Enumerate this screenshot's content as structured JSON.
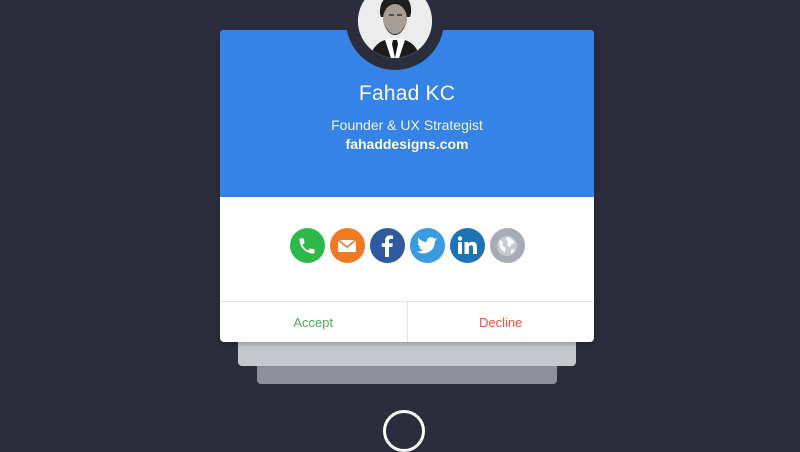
{
  "profile": {
    "name": "Fahad KC",
    "role": "Founder & UX Strategist",
    "website": "fahaddesigns.com"
  },
  "social_icons": [
    {
      "icon": "phone-icon",
      "color": "#2fb84a"
    },
    {
      "icon": "email-icon",
      "color": "#f07a24"
    },
    {
      "icon": "facebook-icon",
      "color": "#2f5aa0"
    },
    {
      "icon": "twitter-icon",
      "color": "#3b9ae0"
    },
    {
      "icon": "linkedin-icon",
      "color": "#1e73b5"
    },
    {
      "icon": "globe-icon",
      "color": "#a6abb6"
    }
  ],
  "actions": {
    "accept_label": "Accept",
    "decline_label": "Decline"
  },
  "colors": {
    "background": "#2b2d3c",
    "header": "#3583e6",
    "accept": "#4caf50",
    "decline": "#f2523e"
  }
}
